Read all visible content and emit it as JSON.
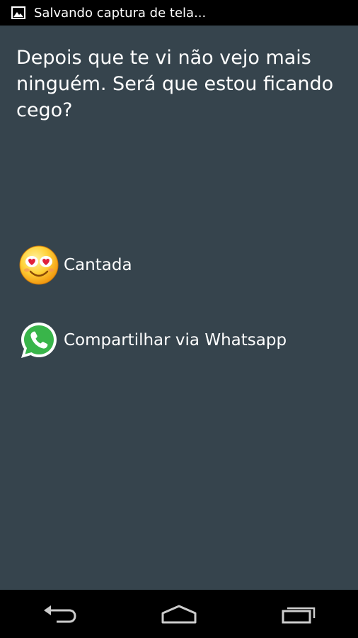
{
  "status_bar": {
    "notification_icon": "image-icon",
    "notification_text": "Salvando captura de tela..."
  },
  "main": {
    "quote": "Depois que te vi não vejo mais ninguém. Será que estou ficando cego?",
    "actions": [
      {
        "icon": "heart-eyes-emoji-icon",
        "label": "Cantada"
      },
      {
        "icon": "whatsapp-icon",
        "label": "Compartilhar via Whatsapp"
      }
    ]
  },
  "nav_bar": {
    "buttons": [
      "back-icon",
      "home-icon",
      "recent-apps-icon"
    ]
  },
  "colors": {
    "background": "#36444d",
    "status_bar": "#000000",
    "nav_bar": "#000000",
    "text": "#ffffff",
    "whatsapp_green": "#39b54a"
  }
}
